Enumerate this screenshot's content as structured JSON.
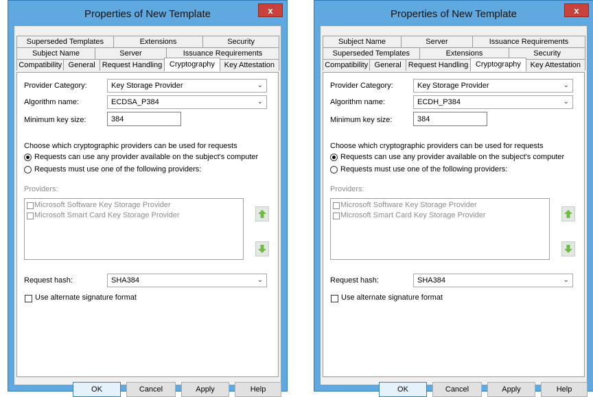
{
  "windows": [
    {
      "title": "Properties of New Template",
      "close_label": "x",
      "tab_rows": [
        [
          "Superseded Templates",
          "Extensions",
          "Security"
        ],
        [
          "Subject Name",
          "Server",
          "Issuance Requirements"
        ],
        [
          "Compatibility",
          "General",
          "Request Handling",
          "Cryptography",
          "Key Attestation"
        ]
      ],
      "active_tab": "Cryptography",
      "provider_category": {
        "label": "Provider Category:",
        "value": "Key Storage Provider"
      },
      "algorithm_name": {
        "label": "Algorithm name:",
        "value": "ECDSA_P384"
      },
      "min_key_size": {
        "label": "Minimum key size:",
        "value": "384"
      },
      "choose_text": "Choose which cryptographic providers can be used for requests",
      "radio_any": "Requests can use any provider available on the subject's computer",
      "radio_must": "Requests must use one of the following providers:",
      "radio_selected": "any",
      "providers_label": "Providers:",
      "providers": [
        {
          "label": "Microsoft Software Key Storage Provider",
          "checked": false
        },
        {
          "label": "Microsoft Smart Card Key Storage Provider",
          "checked": false
        }
      ],
      "request_hash": {
        "label": "Request hash:",
        "value": "SHA384"
      },
      "alt_signature": {
        "label": "Use alternate signature format",
        "checked": false
      },
      "buttons": {
        "ok": "OK",
        "cancel": "Cancel",
        "apply": "Apply",
        "help": "Help"
      }
    },
    {
      "title": "Properties of New Template",
      "close_label": "x",
      "tab_rows": [
        [
          "Subject Name",
          "Server",
          "Issuance Requirements"
        ],
        [
          "Superseded Templates",
          "Extensions",
          "Security"
        ],
        [
          "Compatibility",
          "General",
          "Request Handling",
          "Cryptography",
          "Key Attestation"
        ]
      ],
      "active_tab": "Cryptography",
      "provider_category": {
        "label": "Provider Category:",
        "value": "Key Storage Provider"
      },
      "algorithm_name": {
        "label": "Algorithm name:",
        "value": "ECDH_P384"
      },
      "min_key_size": {
        "label": "Minimum key size:",
        "value": "384"
      },
      "choose_text": "Choose which cryptographic providers can be used for requests",
      "radio_any": "Requests can use any provider available on the subject's computer",
      "radio_must": "Requests must use one of the following providers:",
      "radio_selected": "any",
      "providers_label": "Providers:",
      "providers": [
        {
          "label": "Microsoft Software Key Storage Provider",
          "checked": false
        },
        {
          "label": "Microsoft Smart Card Key Storage Provider",
          "checked": false
        }
      ],
      "request_hash": {
        "label": "Request hash:",
        "value": "SHA384"
      },
      "alt_signature": {
        "label": "Use alternate signature format",
        "checked": false
      },
      "buttons": {
        "ok": "OK",
        "cancel": "Cancel",
        "apply": "Apply",
        "help": "Help"
      }
    }
  ],
  "colors": {
    "title_bar": "#5fa9e0",
    "close_button": "#c7423a",
    "arrow_green": "#6cbf3c"
  }
}
